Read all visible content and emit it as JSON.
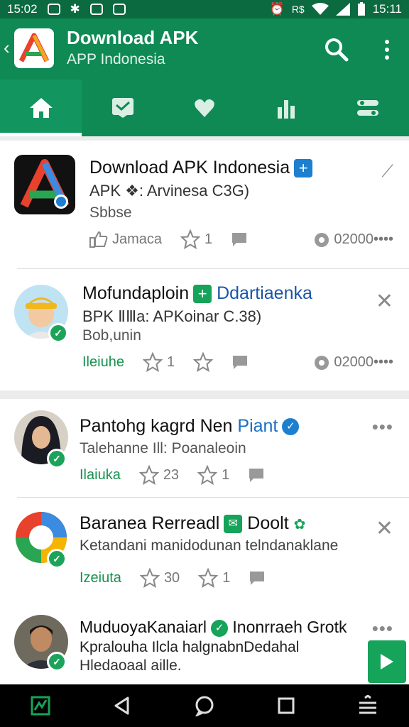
{
  "status_bar": {
    "time_left": "15:02",
    "time_right": "15:11"
  },
  "header": {
    "title": "Download APK",
    "subtitle": "APP Indonesia"
  },
  "tabs": [
    {
      "name": "home",
      "icon": "home-icon"
    },
    {
      "name": "messages",
      "icon": "message-icon"
    },
    {
      "name": "favorites",
      "icon": "heart-icon"
    },
    {
      "name": "stats",
      "icon": "bar-chart-icon"
    },
    {
      "name": "settings",
      "icon": "settings-icon"
    }
  ],
  "colors": {
    "primary": "#0f8a55",
    "status_bar": "#0b6a3f",
    "accent_green": "#16a35a",
    "verified_blue": "#1c7fd0"
  },
  "posts": [
    {
      "title": "Download APK Indonesia",
      "line2": "APK ❖: Arvinesa C3G)",
      "line3": "Sbbse",
      "like_label": "Jamaca",
      "star_count": "1",
      "views": "02000••••"
    },
    {
      "title": "Mofundaploin",
      "title_link": "Ddartiaenka",
      "line2": "BPK ⅡⅢa: APKoinar C.38)",
      "line3": "Bob,unin",
      "status_label": "Ileiuhe",
      "star_count": "1",
      "views": "02000••••"
    },
    {
      "title": "Pantohg kagrd Nen",
      "title_link": "Piant",
      "line2": "Talehanne Ill: Poanaleoin",
      "status_label": "Ilaiuka",
      "star_count_a": "23",
      "star_count_b": "1"
    },
    {
      "title": "Baranea Rerreadl",
      "title_link": "Doolt",
      "line2": "Ketandani manidodunan telndanaklane",
      "status_label": "Izeiuta",
      "star_count_a": "30",
      "star_count_b": "1"
    },
    {
      "title": "MuduoyaKanaiarl",
      "title_link": "Inonrraeh Grotk",
      "line2": "Kpralouha Ilcla halgnabnDedahal",
      "line3": "Hledaoaal aille."
    }
  ]
}
